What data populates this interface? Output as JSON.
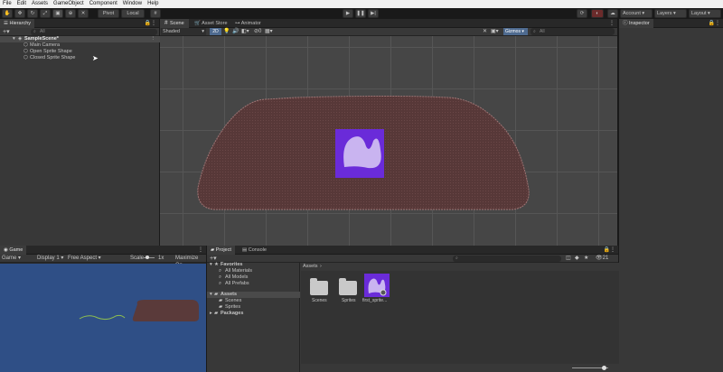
{
  "menu": [
    "File",
    "Edit",
    "Assets",
    "GameObject",
    "Component",
    "Window",
    "Help"
  ],
  "toolbar": {
    "pivot": "Pivot",
    "local": "Local",
    "account": "Account",
    "layers": "Layers",
    "layout": "Layout"
  },
  "hierarchy": {
    "tab": "Hierarchy",
    "search_placeholder": "All",
    "scene": "SampleScene*",
    "children": [
      "Main Camera",
      "Open Sprite Shape",
      "Closed Sprite Shape"
    ]
  },
  "scene_view": {
    "tabs": [
      "Scene",
      "Asset Store",
      "Animator"
    ],
    "shading": "Shaded",
    "dim_label": "2D",
    "gizmos": "Gizmos",
    "search_placeholder": "All"
  },
  "inspector": {
    "tab": "Inspector"
  },
  "game_view": {
    "tab": "Game",
    "display_mode": "Game",
    "display": "Display 1",
    "aspect": "Free Aspect",
    "scale_label": "Scale",
    "scale_value": "1x",
    "maximize": "Maximize On"
  },
  "project": {
    "tabs": [
      "Project",
      "Console"
    ],
    "favorites_label": "Favorites",
    "favorites": [
      "All Materials",
      "All Models",
      "All Prefabs"
    ],
    "assets_label": "Assets",
    "asset_folders": [
      "Scenes",
      "Sprites"
    ],
    "packages_label": "Packages",
    "breadcrumb": "Assets",
    "items": [
      "Scenes",
      "Sprites",
      "first_sprite..."
    ],
    "hidden_count": "21"
  },
  "colors": {
    "sprite_shape_fill": "#5a3a3a",
    "sprite_shape_outline": "#a07070",
    "sprite_bg": "#6a2bd9",
    "sprite_fg": "#c9b4f0",
    "game_bg": "#2f4f86",
    "spline_green": "#8fbf4f"
  }
}
